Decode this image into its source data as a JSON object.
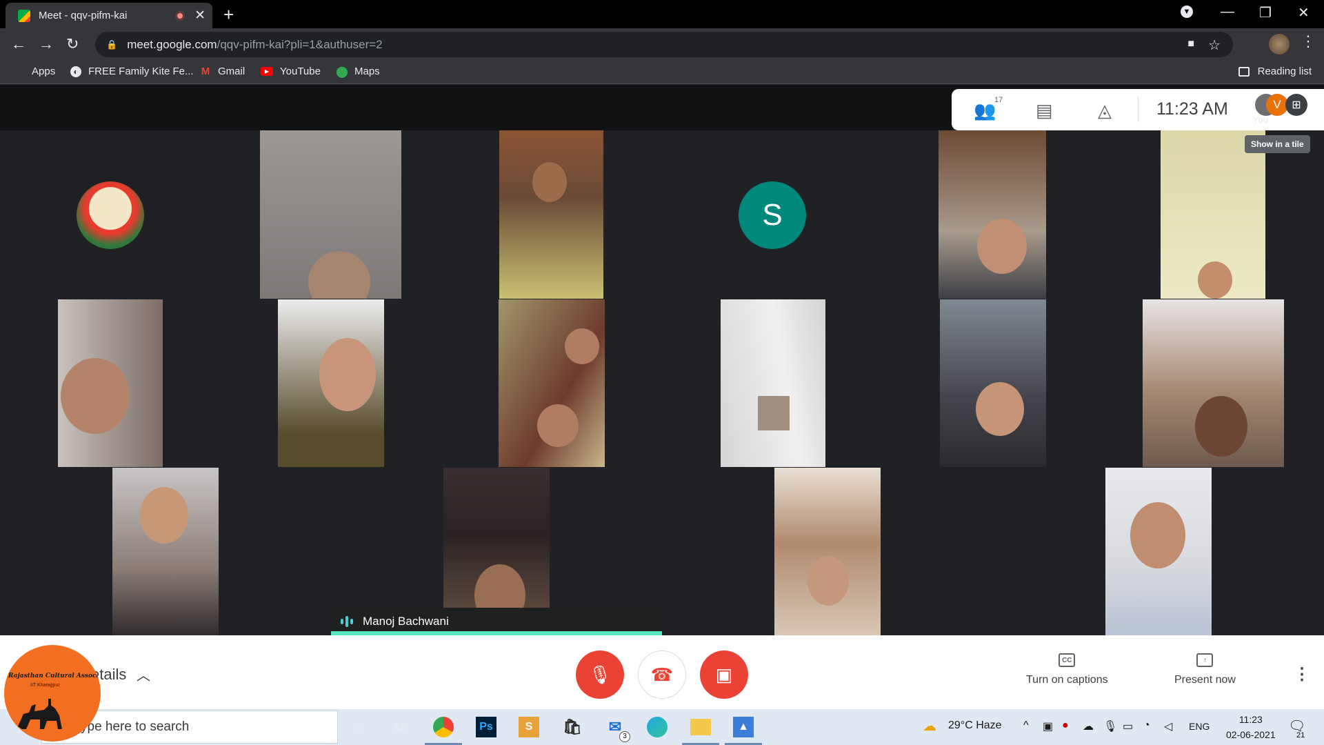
{
  "browser": {
    "tab_title": "Meet - qqv-pifm-kai",
    "url_host": "meet.google.com",
    "url_path": "/qqv-pifm-kai?pli=1&authuser=2",
    "bookmarks": [
      {
        "label": "Apps",
        "icon": "apps-grid-icon"
      },
      {
        "label": "FREE Family Kite Fe...",
        "icon": "globe-icon"
      },
      {
        "label": "Gmail",
        "icon": "gmail-icon"
      },
      {
        "label": "YouTube",
        "icon": "youtube-icon"
      },
      {
        "label": "Maps",
        "icon": "maps-icon"
      }
    ],
    "reading_list": "Reading list"
  },
  "meet": {
    "participant_count": "17",
    "clock": "11:23  AM",
    "self_label": "You",
    "self_initial": "V",
    "tooltip": "Show in a tile",
    "s_initial": "S",
    "active_speaker": "Manoj Bachwani",
    "meeting_details": "etails",
    "captions_label": "Turn on captions",
    "present_label": "Present now",
    "cc_text": "CC"
  },
  "logo": {
    "line1": "Rajasthan Cultural Association",
    "line2": "IIT Kharagpur"
  },
  "taskbar": {
    "search_placeholder": "ype here to search",
    "weather": "29°C  Haze",
    "language": "ENG",
    "time": "11:23",
    "date": "02-06-2021",
    "mail_badge": "3",
    "notif_badge": "21"
  },
  "colors": {
    "accent_teal": "#00897b",
    "end_red": "#ea4335",
    "speaker_line": "#56e3c0"
  }
}
